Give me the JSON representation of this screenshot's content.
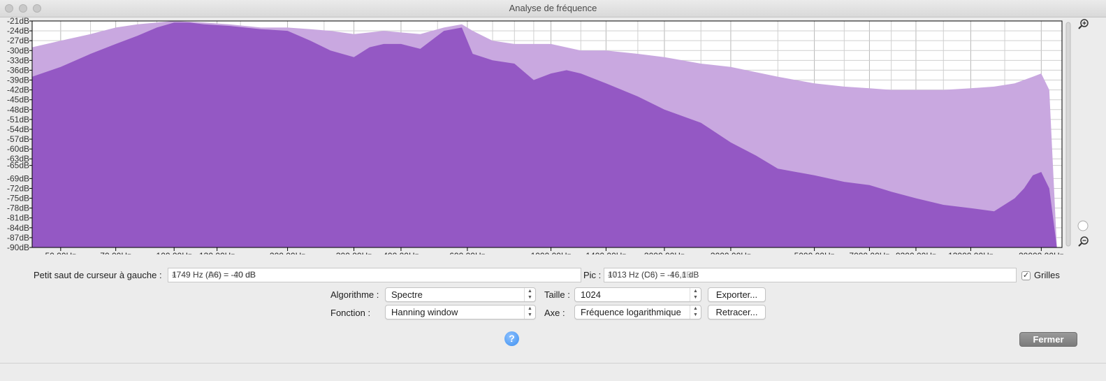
{
  "window": {
    "title": "Analyse de fréquence"
  },
  "chart_data": {
    "type": "area",
    "xscale": "log",
    "xlim": [
      42,
      22700
    ],
    "ylim": [
      -90,
      -21
    ],
    "x_ticks": [
      "50,00Hz",
      "70,00Hz",
      "100,00Hz",
      "130,00Hz",
      "200,00Hz",
      "300,00Hz",
      "400,00Hz",
      "600,00Hz",
      "1000,00Hz",
      "1400,00Hz",
      "2000,00Hz",
      "3000,00Hz",
      "5000,00Hz",
      "7000,00Hz",
      "9300,00Hz",
      "13000,00Hz",
      "20000,00Hz"
    ],
    "x_tick_values": [
      50,
      70,
      100,
      130,
      200,
      300,
      400,
      600,
      1000,
      1400,
      2000,
      3000,
      5000,
      7000,
      9300,
      13000,
      20000
    ],
    "y_ticks": [
      "-21dB",
      "-24dB",
      "-27dB",
      "-30dB",
      "-33dB",
      "-36dB",
      "-39dB",
      "-42dB",
      "-45dB",
      "-48dB",
      "-51dB",
      "-54dB",
      "-57dB",
      "-60dB",
      "-63dB",
      "-65dB",
      "-69dB",
      "-72dB",
      "-75dB",
      "-78dB",
      "-81dB",
      "-84dB",
      "-87dB",
      "-90dB"
    ],
    "y_tick_values": [
      -21,
      -24,
      -27,
      -30,
      -33,
      -36,
      -39,
      -42,
      -45,
      -48,
      -51,
      -54,
      -57,
      -60,
      -63,
      -65,
      -69,
      -72,
      -75,
      -78,
      -81,
      -84,
      -87,
      -90
    ],
    "grid": true,
    "series": [
      {
        "color": "#c9a8e0",
        "x": [
          42,
          50,
          60,
          70,
          80,
          100,
          120,
          140,
          170,
          200,
          230,
          260,
          300,
          330,
          360,
          400,
          450,
          520,
          580,
          620,
          700,
          800,
          900,
          1000,
          1200,
          1400,
          1700,
          2000,
          2500,
          3000,
          4000,
          5000,
          6000,
          7000,
          8000,
          9300,
          11000,
          13000,
          15000,
          17000,
          19000,
          20000,
          21000,
          22000
        ],
        "y": [
          -29,
          -27,
          -25,
          -23,
          -22,
          -21,
          -21.5,
          -22,
          -23,
          -23,
          -23.5,
          -24,
          -25,
          -24.5,
          -24,
          -24.5,
          -25,
          -23,
          -22,
          -24,
          -27,
          -28,
          -28,
          -28,
          -30,
          -30,
          -31,
          -32,
          -34,
          -35,
          -38,
          -40,
          -41,
          -41.5,
          -42,
          -42,
          -42,
          -41.5,
          -41,
          -40,
          -38,
          -37,
          -42,
          -90
        ]
      },
      {
        "color": "#9458c4",
        "x": [
          42,
          50,
          60,
          70,
          80,
          90,
          100,
          110,
          120,
          140,
          170,
          200,
          230,
          260,
          300,
          330,
          360,
          400,
          450,
          520,
          580,
          620,
          700,
          800,
          900,
          1000,
          1100,
          1200,
          1400,
          1700,
          2000,
          2500,
          3000,
          3500,
          4000,
          5000,
          6000,
          7000,
          8000,
          9300,
          11000,
          13000,
          15000,
          17000,
          18000,
          19000,
          20000,
          21000,
          22000
        ],
        "y": [
          -38,
          -35,
          -31,
          -28,
          -25.5,
          -23,
          -21.5,
          -21.5,
          -22,
          -22.5,
          -23.5,
          -24,
          -27,
          -30,
          -32,
          -29,
          -28,
          -28,
          -29.5,
          -24,
          -23,
          -31,
          -33,
          -34,
          -39,
          -37,
          -36,
          -37,
          -40,
          -44,
          -48,
          -52,
          -58,
          -62,
          -66,
          -68,
          -70,
          -71,
          -73,
          -75,
          -77,
          -78,
          -79,
          -75,
          -72,
          -68,
          -67,
          -72,
          -90
        ]
      }
    ]
  },
  "cursor": {
    "label": "Petit saut de curseur à gauche :",
    "value": "1749 Hz (A6) = -40 dB",
    "ghost": "4749 Hz (D8) = -20 dB"
  },
  "peak": {
    "label": "Pic :",
    "value": "1013 Hz (C6) = -46,1 dB",
    "ghost": "4713 Hz (D8) = -16 dB"
  },
  "grids": {
    "label": "Grilles",
    "checked": true,
    "check_glyph": "✓"
  },
  "algorithm": {
    "label": "Algorithme :",
    "value": "Spectre"
  },
  "size": {
    "label": "Taille :",
    "value": "1024"
  },
  "function": {
    "label": "Fonction :",
    "value": "Hanning window"
  },
  "axis": {
    "label": "Axe :",
    "value": "Fréquence logarithmique"
  },
  "buttons": {
    "export": "Exporter...",
    "replot": "Retracer...",
    "close": "Fermer",
    "help": "?"
  },
  "icons": {
    "zoom_in": "zoom-in-icon",
    "zoom_out": "zoom-out-icon"
  }
}
